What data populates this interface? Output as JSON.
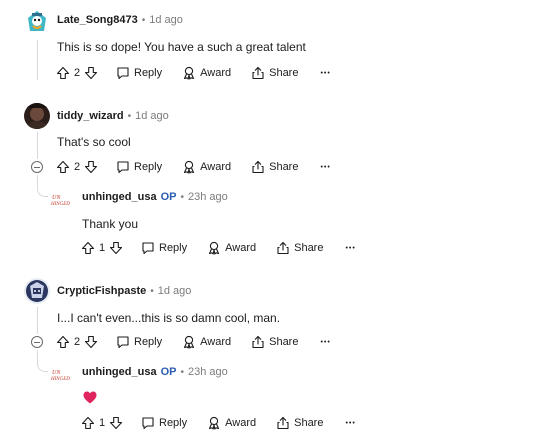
{
  "comments": [
    {
      "username": "Late_Song8473",
      "separator": "•",
      "time": "1d ago",
      "text": "This is so dope! You have a such a great talent",
      "votes": "2",
      "reply_label": "Reply",
      "award_label": "Award",
      "share_label": "Share",
      "more_label": "•••"
    },
    {
      "username": "tiddy_wizard",
      "separator": "•",
      "time": "1d ago",
      "text": "That's so cool",
      "votes": "2",
      "reply_label": "Reply",
      "award_label": "Award",
      "share_label": "Share",
      "more_label": "•••",
      "reply": {
        "username": "unhinged_usa",
        "op_badge": "OP",
        "separator": "•",
        "time": "23h ago",
        "text": "Thank you",
        "votes": "1",
        "reply_label": "Reply",
        "award_label": "Award",
        "share_label": "Share",
        "more_label": "•••"
      }
    },
    {
      "username": "CrypticFishpaste",
      "separator": "•",
      "time": "1d ago",
      "text": "I...I can't even...this is so damn cool, man.",
      "votes": "2",
      "reply_label": "Reply",
      "award_label": "Award",
      "share_label": "Share",
      "more_label": "•••",
      "reply": {
        "username": "unhinged_usa",
        "op_badge": "OP",
        "separator": "•",
        "time": "23h ago",
        "text_icon": "red-heart-emoji",
        "votes": "1",
        "reply_label": "Reply",
        "award_label": "Award",
        "share_label": "Share",
        "more_label": "•••"
      }
    }
  ],
  "colors": {
    "op": "#2a5db0",
    "meta": "#7c7c7c",
    "thread_line": "#d7dadc",
    "heart": "#e0245e"
  }
}
